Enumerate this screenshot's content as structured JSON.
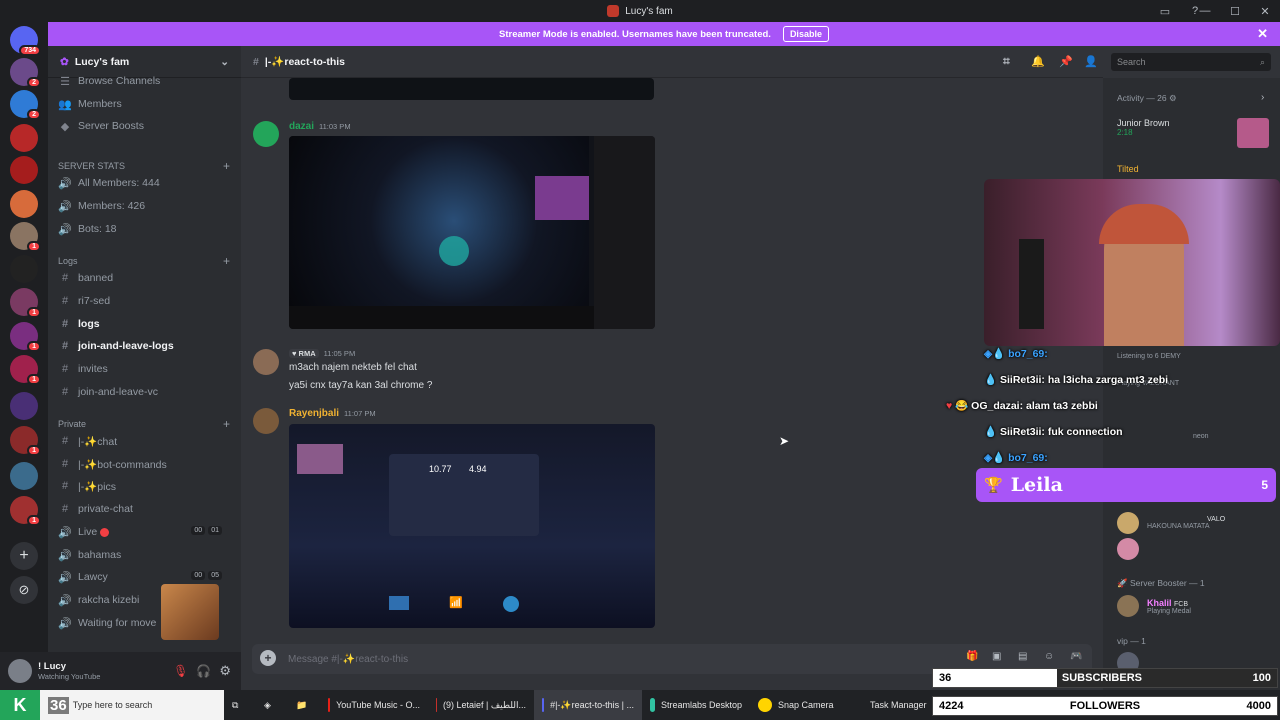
{
  "window": {
    "title": "Lucy's fam"
  },
  "banner": {
    "text": "Streamer Mode is enabled. Usernames have been truncated.",
    "button": "Disable"
  },
  "rail": {
    "top_badge": "734",
    "badges": [
      "2",
      "2",
      "1",
      "1",
      "1",
      "1",
      "1",
      "1",
      "1"
    ]
  },
  "server": {
    "name": "Lucy's fam"
  },
  "channels": {
    "browse": "Browse Channels",
    "members": "Members",
    "boosts": "Server Boosts",
    "stats_category": "SERVER STATS",
    "stats": [
      "All Members: 444",
      "Members: 426",
      "Bots: 18"
    ],
    "logs_category": "Logs",
    "logs": [
      "banned",
      "ri7-sed",
      "logs",
      "join-and-leave-logs",
      "invites",
      "join-and-leave-vc"
    ],
    "private_category": "Private",
    "private": [
      "|-✨chat",
      "|-✨bot-commands",
      "|-✨pics",
      "private-chat",
      "Live",
      "bahamas",
      "Lawcy",
      "rakcha kizebi",
      "Waiting for move"
    ],
    "live_counts": [
      "00",
      "01"
    ],
    "lawcy_counts": [
      "00",
      "05"
    ]
  },
  "user": {
    "name": "! Lucy",
    "status": "Watching YouTube"
  },
  "channel_header": {
    "name": "|-✨react-to-this"
  },
  "search": {
    "placeholder": "Search"
  },
  "messages": [
    {
      "author": "dazai",
      "time": "11:03 PM"
    },
    {
      "author": "",
      "tag": "RMA",
      "time": "11:05 PM",
      "lines": [
        "m3ach najem nekteb fel chat",
        "ya5i cnx tay7a kan 3al chrome ?"
      ]
    },
    {
      "author": "Rayenjbali",
      "time": "11:07 PM"
    }
  ],
  "speedtest": {
    "v1": "10.77",
    "v2": "4.94"
  },
  "composer": {
    "placeholder": "Message #|-✨react-to-this"
  },
  "member_panel": {
    "activity": "Activity — 26",
    "junior": "Junior Brown",
    "junior_sub": "2:18",
    "tilted": "Tilted",
    "hakouna": "HAKOUNA MATATA",
    "valo": "VALO",
    "booster_group": "Server Booster — 1",
    "khalil": "Khalil",
    "fcb": "FCB",
    "khalil_status": "Playing Medal",
    "vip_group": "vip — 1",
    "listening": "Listening to 6 DEMY",
    "playing_valorant": "Playing VALORANT",
    "neon": "neon"
  },
  "stream_chat": [
    {
      "user": "bo7_69:",
      "text": ""
    },
    {
      "user": "SiiRet3ii:",
      "text": "ha l3icha zarga mt3 zebi"
    },
    {
      "user": "OG_dazai:",
      "text": "alam ta3 zebbi"
    },
    {
      "user": "SiiRet3ii:",
      "text": "fuk connection"
    },
    {
      "user": "bo7_69:",
      "text": ""
    }
  ],
  "leaderboard": {
    "name": "Leila",
    "count": "5"
  },
  "goals": {
    "subs": {
      "current": "36",
      "label": "SUBSCRIBERS",
      "target": "100",
      "progress": 0.36
    },
    "followers": {
      "current": "4224",
      "label": "FOLLOWERS",
      "target": "4000",
      "progress": 1.0
    }
  },
  "taskbar": {
    "search": "Type here to search",
    "start_overlay": "36",
    "items": [
      "YouTube Music - O...",
      "(9) Letaief | اللطيف...",
      "#|-✨react-to-this | ...",
      "Streamlabs Desktop",
      "Snap Camera",
      "Task Manager"
    ]
  },
  "colors": {
    "accent": "#a855f7",
    "discord_green": "#23a55a",
    "link": "#00a8fc"
  }
}
